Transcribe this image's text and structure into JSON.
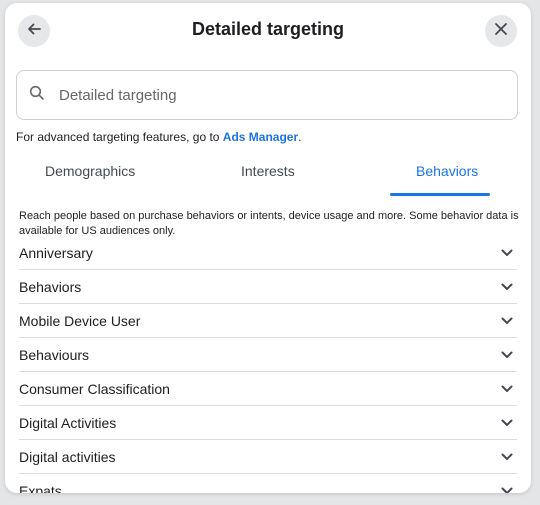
{
  "header": {
    "title": "Detailed targeting",
    "back_icon": "arrow-left-icon",
    "close_icon": "close-icon"
  },
  "search": {
    "placeholder": "Detailed targeting",
    "value": "",
    "icon": "search-icon"
  },
  "advanced": {
    "text": "For advanced targeting features, go to ",
    "link_label": "Ads Manager",
    "suffix": "."
  },
  "tabs": [
    {
      "label": "Demographics",
      "active": false
    },
    {
      "label": "Interests",
      "active": false
    },
    {
      "label": "Behaviors",
      "active": true
    }
  ],
  "description": "Reach people based on purchase behaviors or intents, device usage and more. Some behavior data is available for US audiences only.",
  "categories": [
    {
      "label": "Anniversary"
    },
    {
      "label": "Behaviors"
    },
    {
      "label": "Mobile Device User"
    },
    {
      "label": "Behaviours"
    },
    {
      "label": "Consumer Classification"
    },
    {
      "label": "Digital Activities"
    },
    {
      "label": "Digital activities"
    },
    {
      "label": "Expats"
    }
  ],
  "colors": {
    "accent": "#1b74e4",
    "text": "#1c1e21",
    "button_bg": "#e6e7e9"
  }
}
